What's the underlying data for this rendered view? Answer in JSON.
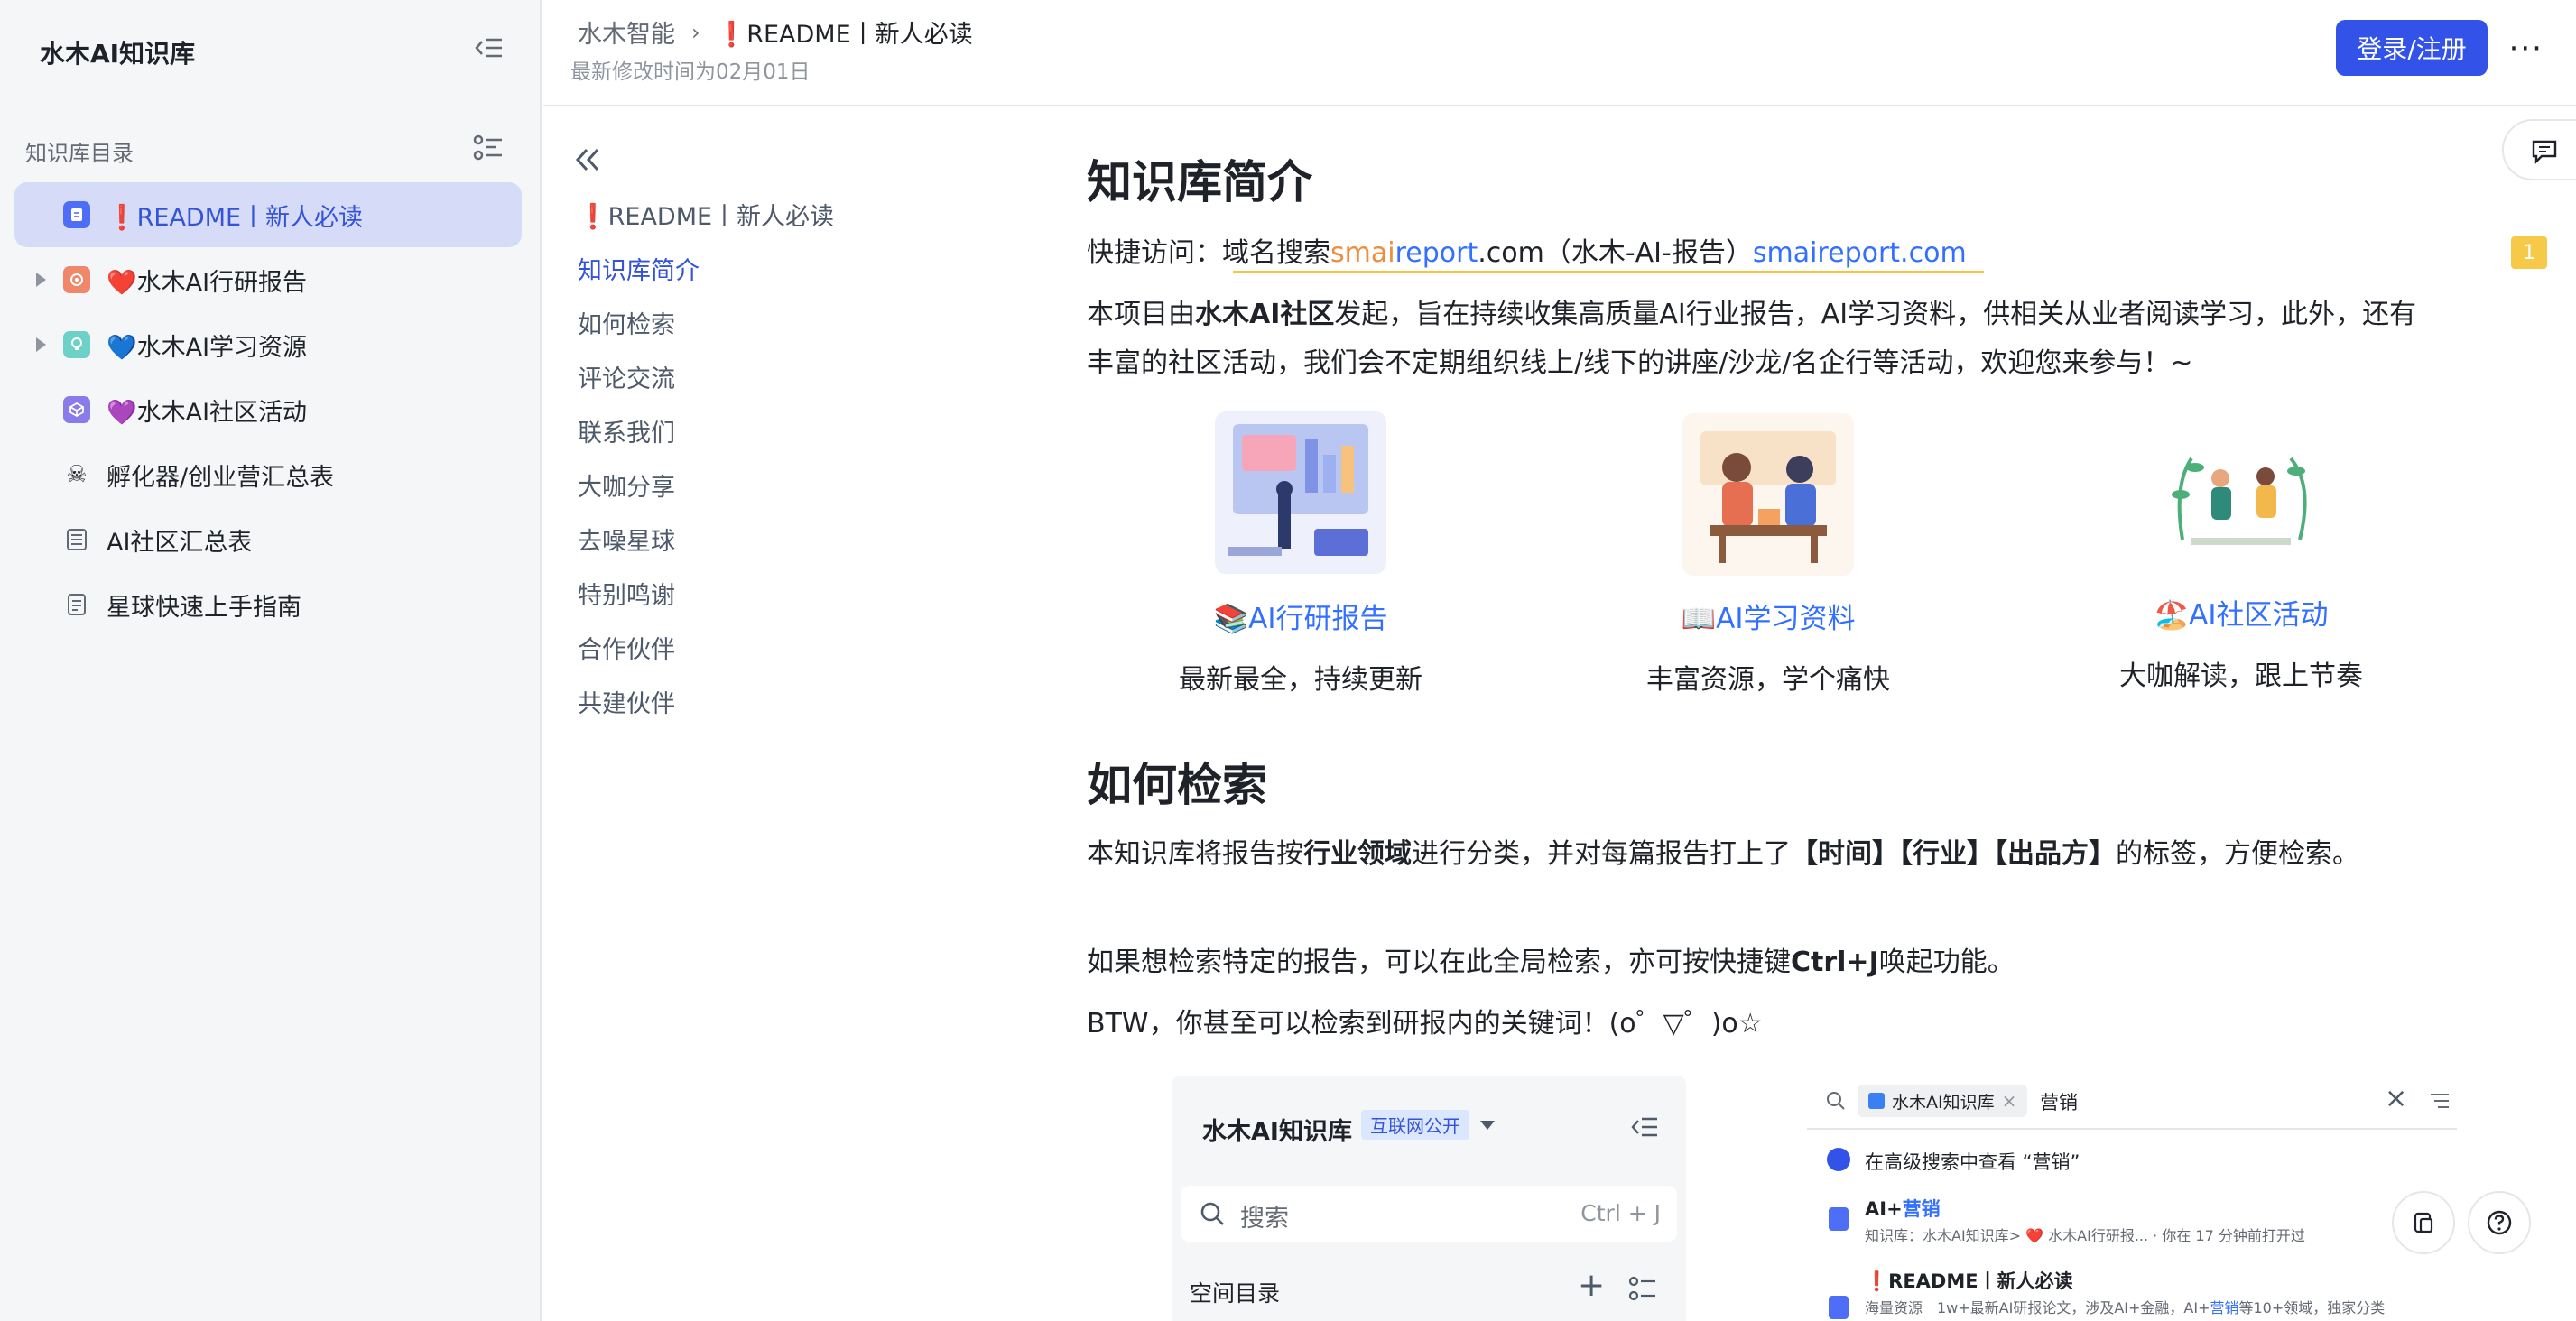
{
  "sidebar": {
    "title": "水木AI知识库",
    "section_label": "知识库目录",
    "items": [
      {
        "label": "❗README丨新人必读",
        "icon": "doc-icon",
        "color": "#4f6ef7"
      },
      {
        "label": "❤️水木AI行研报告",
        "icon": "report-icon",
        "color": "#f0866a"
      },
      {
        "label": "💙水木AI学习资源",
        "icon": "lightbulb-icon",
        "color": "#6dd1c8"
      },
      {
        "label": "💜水木AI社区活动",
        "icon": "cube-icon",
        "color": "#8a7bea"
      },
      {
        "label": "孵化器/创业营汇总表",
        "icon": "skull-icon",
        "color": "#646a73"
      },
      {
        "label": "AI社区汇总表",
        "icon": "table-icon",
        "color": "#646a73"
      },
      {
        "label": "星球快速上手指南",
        "icon": "page-icon",
        "color": "#646a73"
      }
    ]
  },
  "header": {
    "crumb_root": "水木智能",
    "crumb_current": "❗README丨新人必读",
    "modified": "最新修改时间为02月01日",
    "login_label": "登录/注册",
    "more_label": "···"
  },
  "toc": {
    "title": "❗README丨新人必读",
    "items": [
      "知识库简介",
      "如何检索",
      "评论交流",
      "联系我们",
      "大咖分享",
      "去噪星球",
      "特别鸣谢",
      "合作伙伴",
      "共建伙伴"
    ]
  },
  "content": {
    "h1_intro": "知识库简介",
    "quick_prefix": "快捷访问：域名搜索",
    "quick_smai": "smai",
    "quick_report": "report",
    "quick_com": ".com（水木-AI-报告）",
    "quick_link": "smaireport.com",
    "intro_a": "本项目由",
    "intro_b": "水木AI社区",
    "intro_c": "发起，旨在持续收集高质量AI行业报告，AI学习资料，供相关从业者阅读学习，此外，还有丰富的社区活动，我们会不定期组织线上/线下的讲座/沙龙/名企行等活动，欢迎您来参与！~",
    "cards": [
      {
        "link": "📚AI行研报告",
        "desc": "最新最全，持续更新"
      },
      {
        "link": "📖AI学习资料",
        "desc": "丰富资源，学个痛快"
      },
      {
        "link": "🏖️AI社区活动",
        "desc": "大咖解读，跟上节奏"
      }
    ],
    "h1_search": "如何检索",
    "search_a": "本知识库将报告按",
    "search_b": "行业领域",
    "search_c": "进行分类，并对每篇报告打上了",
    "search_d": "【时间】【行业】【出品方】",
    "search_e": "的标签，方便检索。",
    "search2_a": "如果想检索特定的报告，可以在此全局检索，亦可按快捷键",
    "search2_b": "Ctrl+J",
    "search2_c": "唤起功能。",
    "btw": "BTW，你甚至可以检索到研报内的关键词！(o゜▽゜)o☆"
  },
  "preview_left": {
    "title": "水木AI知识库",
    "badge": "互联网公开",
    "search_placeholder": "搜索",
    "shortcut": "Ctrl + J",
    "section": "空间目录"
  },
  "preview_right": {
    "chip": "水木AI知识库",
    "query": "营销",
    "advanced": "在高级搜索中查看 “营销”",
    "r1_title_a": "AI+",
    "r1_title_b": "营销",
    "r1_meta": "知识库：水木AI知识库> ❤️ 水木AI行研报... · 你在 17 分钟前打开过",
    "r2_title": "❗README丨新人必读",
    "r2_meta_a": "海量资源　1w+最新AI研报论文，涉及AI+金融，AI+",
    "r2_meta_b": "营销",
    "r2_meta_c": "等10+领域，独家分类"
  },
  "side_badge": "1",
  "colors": {
    "accent": "#3353e8",
    "link": "#3370ff",
    "active_bg": "#d6dcf7"
  }
}
